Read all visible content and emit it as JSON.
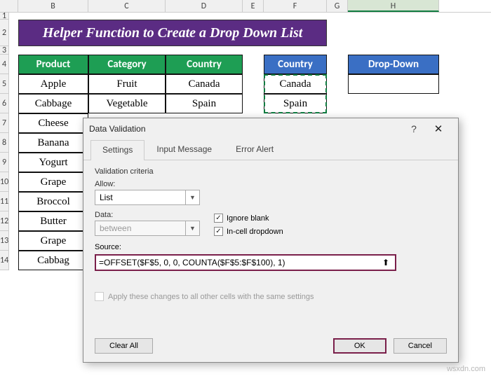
{
  "columns": [
    "B",
    "C",
    "D",
    "E",
    "F",
    "G",
    "H"
  ],
  "rows": [
    "1",
    "2",
    "3",
    "4",
    "5",
    "6",
    "7",
    "8",
    "9",
    "10",
    "11",
    "12",
    "13",
    "14"
  ],
  "title": "Helper Function to Create a Drop Down List",
  "headers": {
    "product": "Product",
    "category": "Category",
    "country_main": "Country",
    "country_side": "Country",
    "dropdown": "Drop-Down"
  },
  "data": {
    "products": [
      "Apple",
      "Cabbage",
      "Cheese",
      "Banana",
      "Yogurt",
      "Grape",
      "Broccol",
      "Butter",
      "Grape",
      "Cabbag"
    ],
    "categories": [
      "Fruit",
      "Vegetable"
    ],
    "countries": [
      "Canada",
      "Spain"
    ],
    "side_countries": [
      "Canada",
      "Spain"
    ]
  },
  "dialog": {
    "title": "Data Validation",
    "tabs": {
      "settings": "Settings",
      "input": "Input Message",
      "error": "Error Alert"
    },
    "criteria_label": "Validation criteria",
    "allow_label": "Allow:",
    "allow_value": "List",
    "data_label": "Data:",
    "data_value": "between",
    "ignore_blank": "Ignore blank",
    "incell": "In-cell dropdown",
    "source_label": "Source:",
    "source_value": "=OFFSET($F$5, 0, 0, COUNTA($F$5:$F$100), 1)",
    "apply_same": "Apply these changes to all other cells with the same settings",
    "clear_all": "Clear All",
    "ok": "OK",
    "cancel": "Cancel"
  },
  "watermark": "wsxdn.com"
}
